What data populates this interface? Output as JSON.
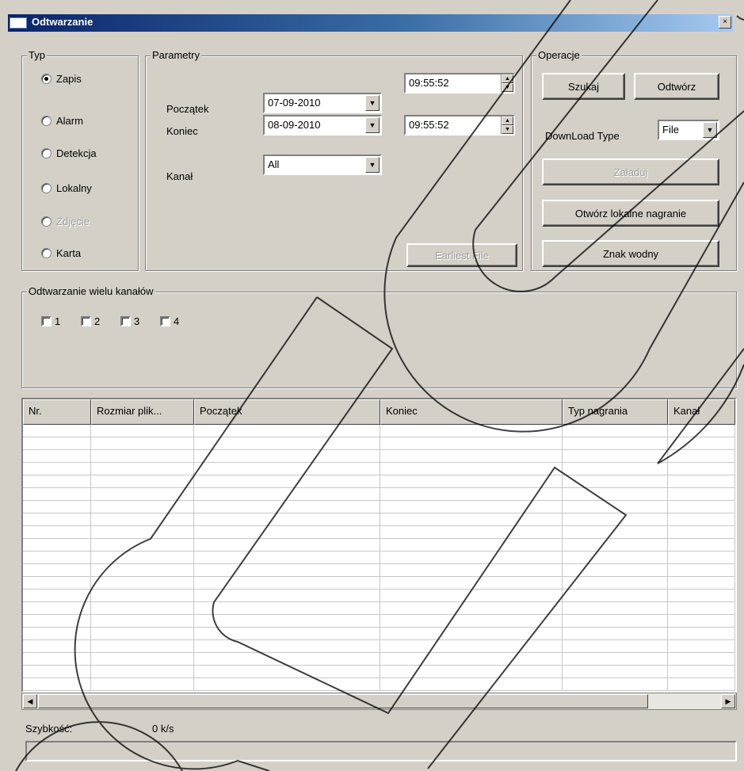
{
  "window": {
    "title": "Odtwarzanie",
    "close_glyph": "×"
  },
  "typ": {
    "legend": "Typ",
    "options": [
      {
        "label": "Zapis",
        "selected": true,
        "enabled": true
      },
      {
        "label": "Alarm",
        "selected": false,
        "enabled": true
      },
      {
        "label": "Detekcja",
        "selected": false,
        "enabled": true
      },
      {
        "label": "Lokalny",
        "selected": false,
        "enabled": true
      },
      {
        "label": "Zdjęcie",
        "selected": false,
        "enabled": false
      },
      {
        "label": "Karta",
        "selected": false,
        "enabled": true
      }
    ]
  },
  "parametry": {
    "legend": "Parametry",
    "start_label": "Początek",
    "start_date": "07-09-2010",
    "start_time": "09:55:52",
    "end_label": "Koniec",
    "end_date": "08-09-2010",
    "end_time": "09:55:52",
    "channel_label": "Kanał",
    "channel_value": "All",
    "earliest_button": "Earliest File"
  },
  "operacje": {
    "legend": "Operacje",
    "search_button": "Szukaj",
    "play_button": "Odtwórz",
    "download_type_label": "DownLoad Type",
    "download_type_value": "File",
    "load_button": "Załaduj",
    "open_local_button": "Otwórz lokalne nagranie",
    "watermark_button": "Znak wodny"
  },
  "multi": {
    "legend": "Odtwarzanie wielu kanałów",
    "channels": [
      "1",
      "2",
      "3",
      "4"
    ]
  },
  "table": {
    "columns": [
      "Nr.",
      "Rozmiar plik...",
      "Początek",
      "Koniec",
      "Typ nagrania",
      "Kanał"
    ]
  },
  "status": {
    "speed_label": "Szybkość:",
    "speed_value": "0 k/s"
  }
}
